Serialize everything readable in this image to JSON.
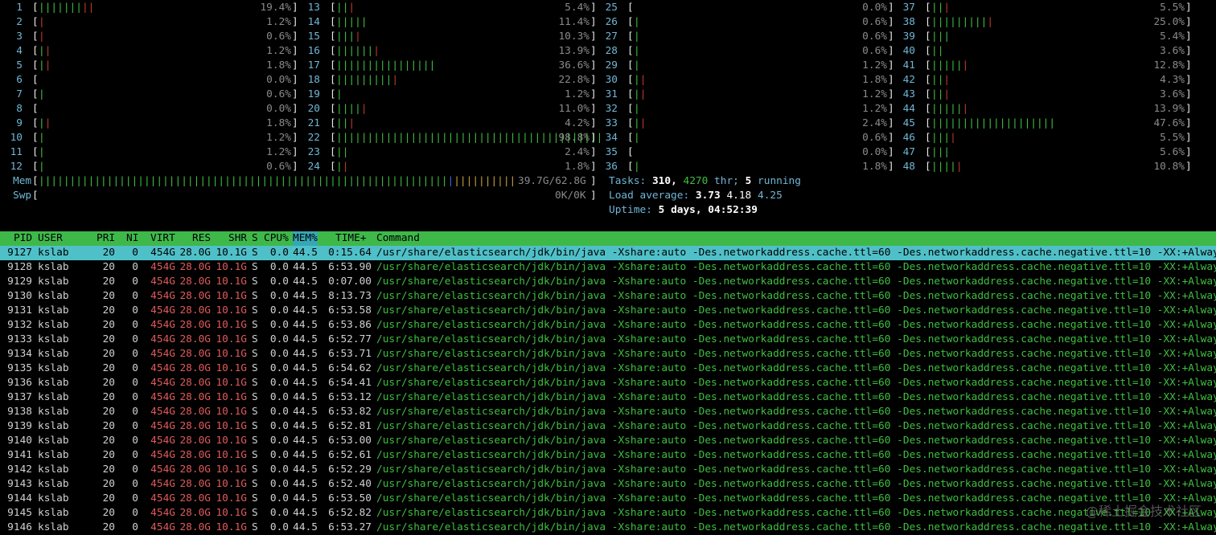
{
  "cpus": [
    {
      "n": "1",
      "pct": "19.4%",
      "g": 7,
      "r": 2
    },
    {
      "n": "2",
      "pct": "1.2%",
      "g": 0,
      "r": 1
    },
    {
      "n": "3",
      "pct": "0.6%",
      "g": 0,
      "r": 1
    },
    {
      "n": "4",
      "pct": "1.2%",
      "g": 1,
      "r": 1
    },
    {
      "n": "5",
      "pct": "1.8%",
      "g": 1,
      "r": 1
    },
    {
      "n": "6",
      "pct": "0.0%",
      "g": 0,
      "r": 0
    },
    {
      "n": "7",
      "pct": "0.6%",
      "g": 1,
      "r": 0
    },
    {
      "n": "8",
      "pct": "0.0%",
      "g": 0,
      "r": 0
    },
    {
      "n": "9",
      "pct": "1.8%",
      "g": 1,
      "r": 1
    },
    {
      "n": "10",
      "pct": "1.2%",
      "g": 1,
      "r": 0
    },
    {
      "n": "11",
      "pct": "1.2%",
      "g": 1,
      "r": 0
    },
    {
      "n": "12",
      "pct": "0.6%",
      "g": 1,
      "r": 0
    },
    {
      "n": "13",
      "pct": "5.4%",
      "g": 2,
      "r": 1
    },
    {
      "n": "14",
      "pct": "11.4%",
      "g": 5,
      "r": 0
    },
    {
      "n": "15",
      "pct": "10.3%",
      "g": 3,
      "r": 1
    },
    {
      "n": "16",
      "pct": "13.9%",
      "g": 6,
      "r": 1
    },
    {
      "n": "17",
      "pct": "36.6%",
      "g": 16,
      "r": 0
    },
    {
      "n": "18",
      "pct": "22.8%",
      "g": 9,
      "r": 1
    },
    {
      "n": "19",
      "pct": "1.2%",
      "g": 1,
      "r": 0
    },
    {
      "n": "20",
      "pct": "11.0%",
      "g": 4,
      "r": 1
    },
    {
      "n": "21",
      "pct": "4.2%",
      "g": 2,
      "r": 1
    },
    {
      "n": "22",
      "pct": "98.8%",
      "g": 43,
      "r": 0
    },
    {
      "n": "23",
      "pct": "2.4%",
      "g": 2,
      "r": 0
    },
    {
      "n": "24",
      "pct": "1.8%",
      "g": 1,
      "r": 1
    },
    {
      "n": "25",
      "pct": "0.0%",
      "g": 0,
      "r": 0
    },
    {
      "n": "26",
      "pct": "0.6%",
      "g": 1,
      "r": 0
    },
    {
      "n": "27",
      "pct": "0.6%",
      "g": 1,
      "r": 0
    },
    {
      "n": "28",
      "pct": "0.6%",
      "g": 1,
      "r": 0
    },
    {
      "n": "29",
      "pct": "1.2%",
      "g": 1,
      "r": 0
    },
    {
      "n": "30",
      "pct": "1.8%",
      "g": 1,
      "r": 1
    },
    {
      "n": "31",
      "pct": "1.2%",
      "g": 1,
      "r": 1
    },
    {
      "n": "32",
      "pct": "1.2%",
      "g": 1,
      "r": 0
    },
    {
      "n": "33",
      "pct": "2.4%",
      "g": 1,
      "r": 1
    },
    {
      "n": "34",
      "pct": "0.6%",
      "g": 1,
      "r": 0
    },
    {
      "n": "35",
      "pct": "0.0%",
      "g": 0,
      "r": 0
    },
    {
      "n": "36",
      "pct": "1.8%",
      "g": 1,
      "r": 0
    },
    {
      "n": "37",
      "pct": "5.5%",
      "g": 2,
      "r": 1
    },
    {
      "n": "38",
      "pct": "25.0%",
      "g": 9,
      "r": 1
    },
    {
      "n": "39",
      "pct": "5.4%",
      "g": 3,
      "r": 0
    },
    {
      "n": "40",
      "pct": "3.6%",
      "g": 2,
      "r": 0
    },
    {
      "n": "41",
      "pct": "12.8%",
      "g": 5,
      "r": 1
    },
    {
      "n": "42",
      "pct": "4.3%",
      "g": 2,
      "r": 1
    },
    {
      "n": "43",
      "pct": "3.6%",
      "g": 2,
      "r": 1
    },
    {
      "n": "44",
      "pct": "13.9%",
      "g": 5,
      "r": 1
    },
    {
      "n": "45",
      "pct": "47.6%",
      "g": 20,
      "r": 0
    },
    {
      "n": "46",
      "pct": "5.5%",
      "g": 3,
      "r": 1
    },
    {
      "n": "47",
      "pct": "5.6%",
      "g": 3,
      "r": 0
    },
    {
      "n": "48",
      "pct": "10.8%",
      "g": 4,
      "r": 1
    }
  ],
  "mem": {
    "label": "Mem",
    "value": "39.7G/62.8G",
    "used_fraction": 0.632
  },
  "swp": {
    "label": "Swp",
    "value": "0K/0K"
  },
  "tasks": {
    "label": "Tasks:",
    "count": "310,",
    "threads": "4270",
    "thr_label": "thr;",
    "running": "5",
    "running_label": "running"
  },
  "load": {
    "label": "Load average:",
    "l1": "3.73",
    "l5": "4.18",
    "l15": "4.25"
  },
  "uptime": {
    "label": "Uptime:",
    "value": "5 days, 04:52:39"
  },
  "header": {
    "pid": "PID",
    "user": "USER",
    "pri": "PRI",
    "ni": "NI",
    "virt": "VIRT",
    "res": "RES",
    "shr": "SHR",
    "s": "S",
    "cpu": "CPU%",
    "mem": "MEM%",
    "time": "TIME+",
    "cmd": "Command"
  },
  "command": "/usr/share/elasticsearch/jdk/bin/java -Xshare:auto -Des.networkaddress.cache.ttl=60 -Des.networkaddress.cache.negative.ttl=10 -XX:+AlwaysPreT",
  "procs": [
    {
      "pid": "9127",
      "user": "kslab",
      "pri": "20",
      "ni": "0",
      "virt": "454G",
      "res": "28.0G",
      "shr": "10.1G",
      "s": "S",
      "cpu": "0.0",
      "mem": "44.5",
      "time": "0:15.64"
    },
    {
      "pid": "9128",
      "user": "kslab",
      "pri": "20",
      "ni": "0",
      "virt": "454G",
      "res": "28.0G",
      "shr": "10.1G",
      "s": "S",
      "cpu": "0.0",
      "mem": "44.5",
      "time": "6:53.90"
    },
    {
      "pid": "9129",
      "user": "kslab",
      "pri": "20",
      "ni": "0",
      "virt": "454G",
      "res": "28.0G",
      "shr": "10.1G",
      "s": "S",
      "cpu": "0.0",
      "mem": "44.5",
      "time": "0:07.00"
    },
    {
      "pid": "9130",
      "user": "kslab",
      "pri": "20",
      "ni": "0",
      "virt": "454G",
      "res": "28.0G",
      "shr": "10.1G",
      "s": "S",
      "cpu": "0.0",
      "mem": "44.5",
      "time": "8:13.73"
    },
    {
      "pid": "9131",
      "user": "kslab",
      "pri": "20",
      "ni": "0",
      "virt": "454G",
      "res": "28.0G",
      "shr": "10.1G",
      "s": "S",
      "cpu": "0.0",
      "mem": "44.5",
      "time": "6:53.58"
    },
    {
      "pid": "9132",
      "user": "kslab",
      "pri": "20",
      "ni": "0",
      "virt": "454G",
      "res": "28.0G",
      "shr": "10.1G",
      "s": "S",
      "cpu": "0.0",
      "mem": "44.5",
      "time": "6:53.86"
    },
    {
      "pid": "9133",
      "user": "kslab",
      "pri": "20",
      "ni": "0",
      "virt": "454G",
      "res": "28.0G",
      "shr": "10.1G",
      "s": "S",
      "cpu": "0.0",
      "mem": "44.5",
      "time": "6:52.77"
    },
    {
      "pid": "9134",
      "user": "kslab",
      "pri": "20",
      "ni": "0",
      "virt": "454G",
      "res": "28.0G",
      "shr": "10.1G",
      "s": "S",
      "cpu": "0.0",
      "mem": "44.5",
      "time": "6:53.71"
    },
    {
      "pid": "9135",
      "user": "kslab",
      "pri": "20",
      "ni": "0",
      "virt": "454G",
      "res": "28.0G",
      "shr": "10.1G",
      "s": "S",
      "cpu": "0.0",
      "mem": "44.5",
      "time": "6:54.62"
    },
    {
      "pid": "9136",
      "user": "kslab",
      "pri": "20",
      "ni": "0",
      "virt": "454G",
      "res": "28.0G",
      "shr": "10.1G",
      "s": "S",
      "cpu": "0.0",
      "mem": "44.5",
      "time": "6:54.41"
    },
    {
      "pid": "9137",
      "user": "kslab",
      "pri": "20",
      "ni": "0",
      "virt": "454G",
      "res": "28.0G",
      "shr": "10.1G",
      "s": "S",
      "cpu": "0.0",
      "mem": "44.5",
      "time": "6:53.12"
    },
    {
      "pid": "9138",
      "user": "kslab",
      "pri": "20",
      "ni": "0",
      "virt": "454G",
      "res": "28.0G",
      "shr": "10.1G",
      "s": "S",
      "cpu": "0.0",
      "mem": "44.5",
      "time": "6:53.82"
    },
    {
      "pid": "9139",
      "user": "kslab",
      "pri": "20",
      "ni": "0",
      "virt": "454G",
      "res": "28.0G",
      "shr": "10.1G",
      "s": "S",
      "cpu": "0.0",
      "mem": "44.5",
      "time": "6:52.81"
    },
    {
      "pid": "9140",
      "user": "kslab",
      "pri": "20",
      "ni": "0",
      "virt": "454G",
      "res": "28.0G",
      "shr": "10.1G",
      "s": "S",
      "cpu": "0.0",
      "mem": "44.5",
      "time": "6:53.00"
    },
    {
      "pid": "9141",
      "user": "kslab",
      "pri": "20",
      "ni": "0",
      "virt": "454G",
      "res": "28.0G",
      "shr": "10.1G",
      "s": "S",
      "cpu": "0.0",
      "mem": "44.5",
      "time": "6:52.61"
    },
    {
      "pid": "9142",
      "user": "kslab",
      "pri": "20",
      "ni": "0",
      "virt": "454G",
      "res": "28.0G",
      "shr": "10.1G",
      "s": "S",
      "cpu": "0.0",
      "mem": "44.5",
      "time": "6:52.29"
    },
    {
      "pid": "9143",
      "user": "kslab",
      "pri": "20",
      "ni": "0",
      "virt": "454G",
      "res": "28.0G",
      "shr": "10.1G",
      "s": "S",
      "cpu": "0.0",
      "mem": "44.5",
      "time": "6:52.40"
    },
    {
      "pid": "9144",
      "user": "kslab",
      "pri": "20",
      "ni": "0",
      "virt": "454G",
      "res": "28.0G",
      "shr": "10.1G",
      "s": "S",
      "cpu": "0.0",
      "mem": "44.5",
      "time": "6:53.50"
    },
    {
      "pid": "9145",
      "user": "kslab",
      "pri": "20",
      "ni": "0",
      "virt": "454G",
      "res": "28.0G",
      "shr": "10.1G",
      "s": "S",
      "cpu": "0.0",
      "mem": "44.5",
      "time": "6:52.82"
    },
    {
      "pid": "9146",
      "user": "kslab",
      "pri": "20",
      "ni": "0",
      "virt": "454G",
      "res": "28.0G",
      "shr": "10.1G",
      "s": "S",
      "cpu": "0.0",
      "mem": "44.5",
      "time": "6:53.27"
    }
  ],
  "selected_pid": "9127",
  "watermark": "@稀土掘金技术社区",
  "colors": {
    "header_bg": "#3fb84a",
    "selected_bg": "#4fc0c8",
    "bar_green": "#3fbf3f",
    "bar_red": "#c0392b",
    "accent_cyan": "#6fb6d6"
  }
}
